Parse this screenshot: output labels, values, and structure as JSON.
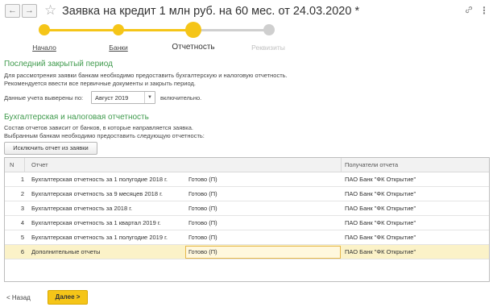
{
  "window": {
    "title": "Заявка на кредит 1 млн руб. на 60 мес. от 24.03.2020 *",
    "back_icon": "←",
    "forward_icon": "→",
    "star_icon": "☆",
    "link_icon": "🔗",
    "more_icon": "⋮"
  },
  "stepper": {
    "steps": [
      {
        "label": "Начало",
        "state": "done"
      },
      {
        "label": "Банки",
        "state": "done"
      },
      {
        "label": "Отчетность",
        "state": "current"
      },
      {
        "label": "Реквизиты",
        "state": "disabled"
      }
    ]
  },
  "period_section": {
    "heading": "Последний закрытый период",
    "description_line1": "Для рассмотрения заявки банкам необходимо предоставить бухгалтерскую и налоговую отчетность.",
    "description_line2": "Рекомендуется ввести все первичные документы и закрыть период.",
    "period_label": "Данные учета выверены по:",
    "period_value": "Август 2019",
    "period_suffix": "включительно."
  },
  "reports_section": {
    "heading": "Бухгалтерская и налоговая отчетность",
    "description_line1": "Состав отчетов зависит от банков, в которые направляется заявка.",
    "description_line2": "Выбранным банкам необходимо предоставить следующую отчетность:",
    "exclude_button": "Исключить отчет из заявки"
  },
  "table": {
    "headers": {
      "n": "N",
      "report": "Отчет",
      "recipients": "Получатели отчета"
    },
    "rows": [
      {
        "n": "1",
        "report": "Бухгалтерская отчетность за 1 полугодие 2018 г.",
        "status": "Готово (П)",
        "recipient": "ПАО Банк \"ФК Открытие\""
      },
      {
        "n": "2",
        "report": "Бухгалтерская отчетность за 9 месяцев 2018 г.",
        "status": "Готово (П)",
        "recipient": "ПАО Банк \"ФК Открытие\""
      },
      {
        "n": "3",
        "report": "Бухгалтерская отчетность за 2018 г.",
        "status": "Готово (П)",
        "recipient": "ПАО Банк \"ФК Открытие\""
      },
      {
        "n": "4",
        "report": "Бухгалтерская отчетность за 1 квартал 2019 г.",
        "status": "Готово (П)",
        "recipient": "ПАО Банк \"ФК Открытие\""
      },
      {
        "n": "5",
        "report": "Бухгалтерская отчетность за 1 полугодие 2019 г.",
        "status": "Готово (П)",
        "recipient": "ПАО Банк \"ФК Открытие\""
      },
      {
        "n": "6",
        "report": "Дополнительные отчеты",
        "status": "Готово (П)",
        "recipient": "ПАО Банк \"ФК Открытие\""
      }
    ],
    "selected_row": 6
  },
  "footer": {
    "back_label": "< Назад",
    "next_label": "Далее >"
  },
  "colors": {
    "accent_yellow": "#f5c518",
    "section_green": "#3f9a4c",
    "inactive_gray": "#cfcfcf",
    "selected_row": "#fbf2c8"
  }
}
